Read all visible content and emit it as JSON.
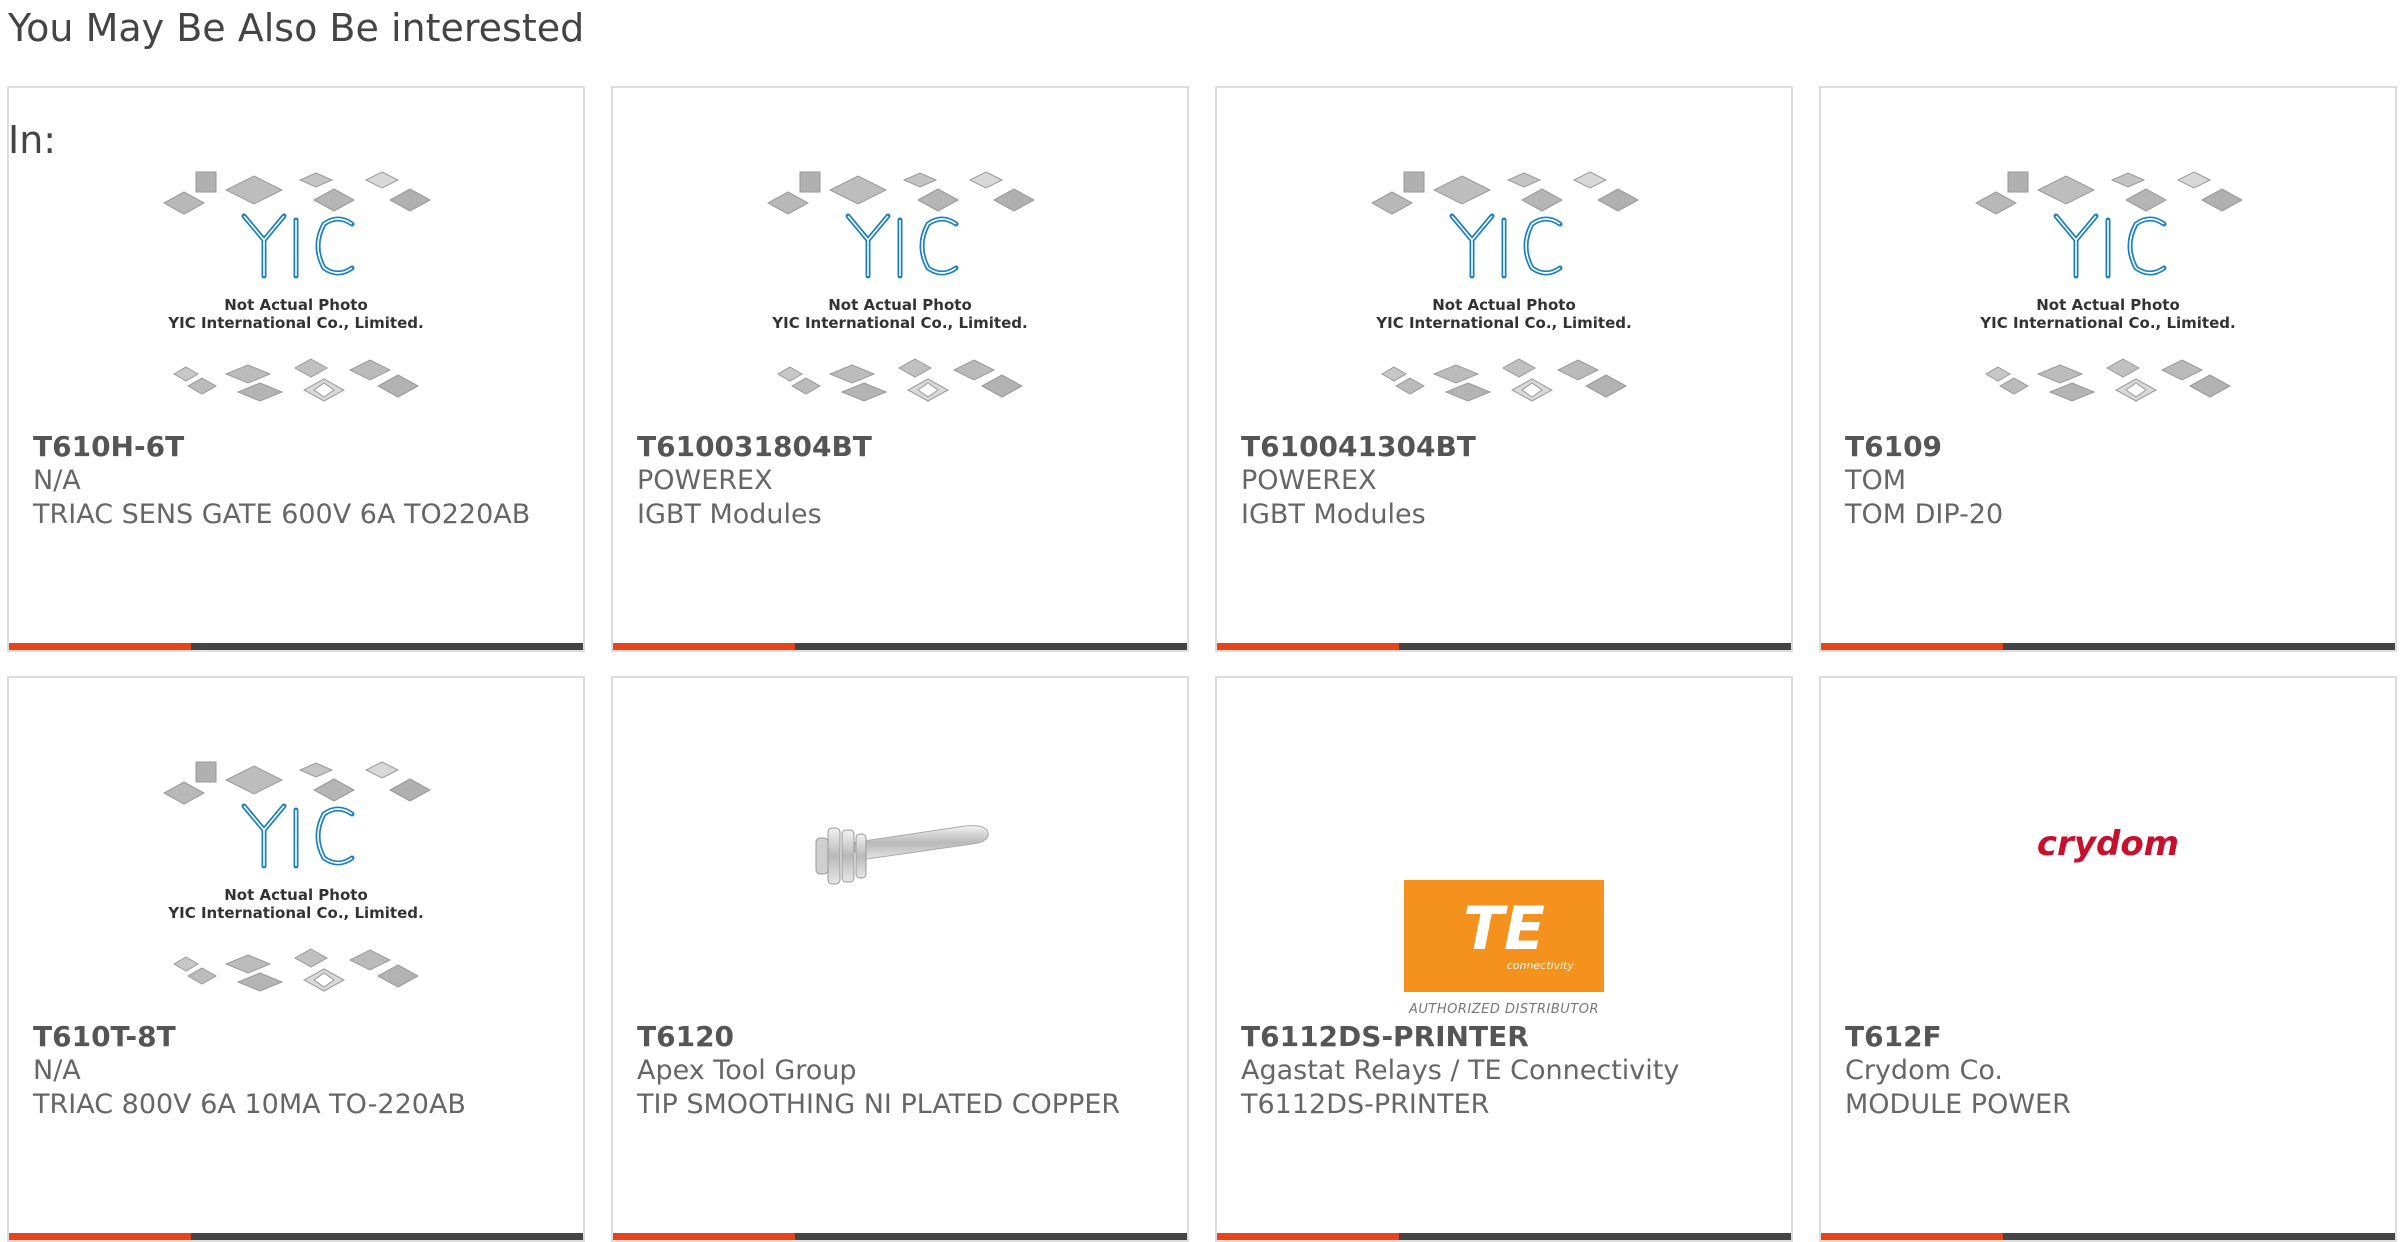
{
  "section": {
    "heading_line1": "You May Be Also Be interested",
    "heading_line2": "In:"
  },
  "colors": {
    "accent": "#e8431a",
    "bar_dark": "#444444",
    "border": "#dddddd",
    "te_orange": "#f5921e",
    "crydom_red": "#c8102e",
    "yic_blue": "#1a7fc1"
  },
  "placeholder": {
    "line1": "Not Actual Photo",
    "line2": "YIC International Co., Limited."
  },
  "logos": {
    "te_text": "TE",
    "te_sub": "connectivity",
    "te_auth": "AUTHORIZED DISTRIBUTOR",
    "crydom_text": "crydom"
  },
  "products": [
    {
      "part": "T610H-6T",
      "manufacturer": "N/A",
      "description": "TRIAC SENS GATE 600V 6A TO220AB",
      "image": "yic-placeholder"
    },
    {
      "part": "T610031804BT",
      "manufacturer": "POWEREX",
      "description": "IGBT Modules",
      "image": "yic-placeholder"
    },
    {
      "part": "T610041304BT",
      "manufacturer": "POWEREX",
      "description": "IGBT Modules",
      "image": "yic-placeholder"
    },
    {
      "part": "T6109",
      "manufacturer": "TOM",
      "description": "TOM DIP-20",
      "image": "yic-placeholder"
    },
    {
      "part": "T610T-8T",
      "manufacturer": "N/A",
      "description": "TRIAC 800V 6A 10MA TO-220AB",
      "image": "yic-placeholder"
    },
    {
      "part": "T6120",
      "manufacturer": "Apex Tool Group",
      "description": "TIP SMOOTHING NI PLATED COPPER",
      "image": "soldering-tip-photo"
    },
    {
      "part": "T6112DS-PRINTER",
      "manufacturer": "Agastat Relays / TE Connectivity",
      "description": "T6112DS-PRINTER",
      "image": "te-connectivity-logo"
    },
    {
      "part": "T612F",
      "manufacturer": "Crydom Co.",
      "description": "MODULE POWER",
      "image": "crydom-logo"
    }
  ]
}
